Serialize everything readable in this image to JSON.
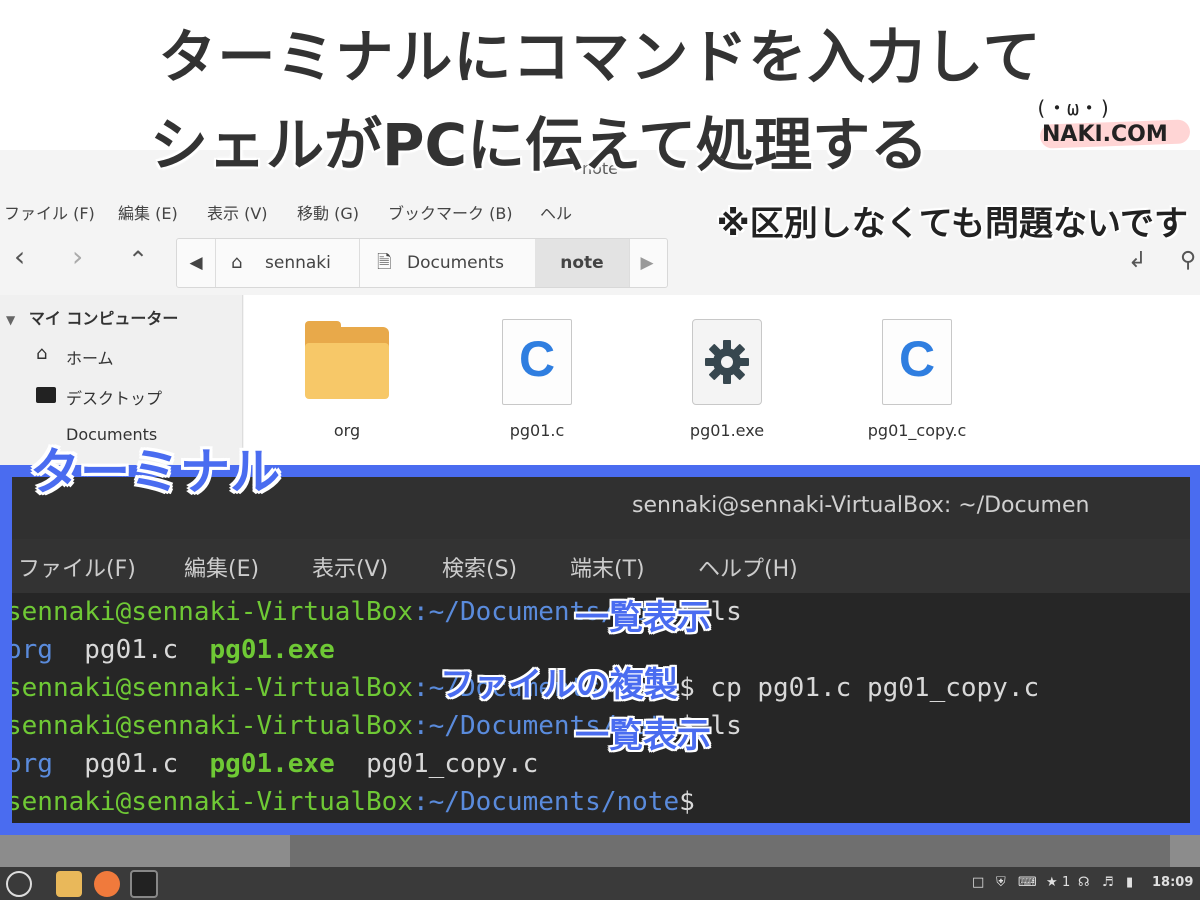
{
  "headline": {
    "line1": "ターミナルにコマンドを入力して",
    "line2": "シェルがPCに伝えて処理する",
    "note": "※区別しなくても問題ないです"
  },
  "logo": {
    "face": "(・ω・)",
    "brand": "NAKI.COM"
  },
  "file_manager": {
    "window_title": "note",
    "menu": [
      "ファイル (F)",
      "編集 (E)",
      "表示 (V)",
      "移動 (G)",
      "ブックマーク (B)",
      "ヘル"
    ],
    "breadcrumbs": [
      "sennaki",
      "Documents",
      "note"
    ],
    "sidebar": {
      "header": "マイ コンピューター",
      "items": [
        "ホーム",
        "デスクトップ",
        "Documents"
      ]
    },
    "files": [
      {
        "name": "org",
        "icon": "folder-icon"
      },
      {
        "name": "pg01.c",
        "icon": "c-file-icon",
        "glyph": "C"
      },
      {
        "name": "pg01.exe",
        "icon": "gear-icon"
      },
      {
        "name": "pg01_copy.c",
        "icon": "c-file-icon",
        "glyph": "C"
      }
    ]
  },
  "terminal": {
    "label": "ターミナル",
    "title": "sennaki@sennaki-VirtualBox: ~/Documen",
    "menu": [
      "ファイル(F)",
      "編集(E)",
      "表示(V)",
      "検索(S)",
      "端末(T)",
      "ヘルプ(H)"
    ],
    "lines": {
      "l1_user": "sennaki@sennaki-VirtualBox",
      "l1_path": ":~/Documents/note",
      "l1_cmd": "$ ls",
      "l2_a": "org",
      "l2_b": "pg01.c",
      "l2_c": "pg01.exe",
      "l3_user": "sennaki@sennaki-VirtualBox",
      "l3_path": ":~/Documents/note",
      "l3_cmd": "$ cp pg01.c pg01_copy.c",
      "l4_user": "sennaki@sennaki-VirtualBox",
      "l4_path": ":~/Documents/note",
      "l4_cmd": "$ ls",
      "l5_a": "org",
      "l5_b": "pg01.c",
      "l5_c": "pg01.exe",
      "l5_d": "pg01_copy.c",
      "l6_user": "sennaki@sennaki-VirtualBox",
      "l6_path": ":~/Documents/note",
      "l6_cmd": "$"
    },
    "annotations": {
      "list1": "一覧表示",
      "copy": "ファイルの複製",
      "list2": "一覧表示"
    }
  },
  "taskbar": {
    "tray_count": "1",
    "clock": "18:09"
  },
  "colors": {
    "accent": "#4a6cf0",
    "terminal_user": "#6fc935",
    "terminal_path": "#5a8bdc"
  }
}
